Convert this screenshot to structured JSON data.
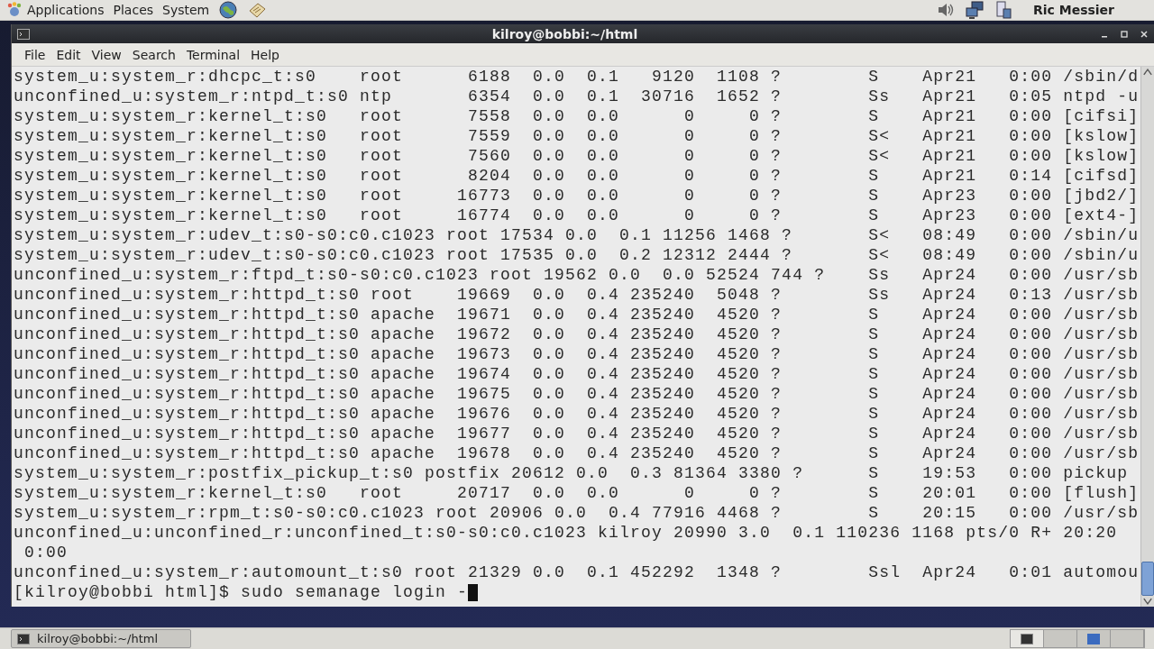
{
  "top_panel": {
    "menus": [
      "Applications",
      "Places",
      "System"
    ],
    "user": "Ric Messier"
  },
  "window": {
    "title": "kilroy@bobbi:~/html",
    "menu": [
      "File",
      "Edit",
      "View",
      "Search",
      "Terminal",
      "Help"
    ],
    "terminal": {
      "lines": [
        "system_u:system_r:dhcpc_t:s0    root      6188  0.0  0.1   9120  1108 ?        S    Apr21   0:00 /sbin/d",
        "unconfined_u:system_r:ntpd_t:s0 ntp       6354  0.0  0.1  30716  1652 ?        Ss   Apr21   0:05 ntpd -u",
        "system_u:system_r:kernel_t:s0   root      7558  0.0  0.0      0     0 ?        S    Apr21   0:00 [cifsi]",
        "system_u:system_r:kernel_t:s0   root      7559  0.0  0.0      0     0 ?        S<   Apr21   0:00 [kslow]",
        "system_u:system_r:kernel_t:s0   root      7560  0.0  0.0      0     0 ?        S<   Apr21   0:00 [kslow]",
        "system_u:system_r:kernel_t:s0   root      8204  0.0  0.0      0     0 ?        S    Apr21   0:14 [cifsd]",
        "system_u:system_r:kernel_t:s0   root     16773  0.0  0.0      0     0 ?        S    Apr23   0:00 [jbd2/]",
        "system_u:system_r:kernel_t:s0   root     16774  0.0  0.0      0     0 ?        S    Apr23   0:00 [ext4-]",
        "system_u:system_r:udev_t:s0-s0:c0.c1023 root 17534 0.0  0.1 11256 1468 ?       S<   08:49   0:00 /sbin/u",
        "system_u:system_r:udev_t:s0-s0:c0.c1023 root 17535 0.0  0.2 12312 2444 ?       S<   08:49   0:00 /sbin/u",
        "unconfined_u:system_r:ftpd_t:s0-s0:c0.c1023 root 19562 0.0  0.0 52524 744 ?    Ss   Apr24   0:00 /usr/sb",
        "unconfined_u:system_r:httpd_t:s0 root    19669  0.0  0.4 235240  5048 ?        Ss   Apr24   0:13 /usr/sb",
        "unconfined_u:system_r:httpd_t:s0 apache  19671  0.0  0.4 235240  4520 ?        S    Apr24   0:00 /usr/sb",
        "unconfined_u:system_r:httpd_t:s0 apache  19672  0.0  0.4 235240  4520 ?        S    Apr24   0:00 /usr/sb",
        "unconfined_u:system_r:httpd_t:s0 apache  19673  0.0  0.4 235240  4520 ?        S    Apr24   0:00 /usr/sb",
        "unconfined_u:system_r:httpd_t:s0 apache  19674  0.0  0.4 235240  4520 ?        S    Apr24   0:00 /usr/sb",
        "unconfined_u:system_r:httpd_t:s0 apache  19675  0.0  0.4 235240  4520 ?        S    Apr24   0:00 /usr/sb",
        "unconfined_u:system_r:httpd_t:s0 apache  19676  0.0  0.4 235240  4520 ?        S    Apr24   0:00 /usr/sb",
        "unconfined_u:system_r:httpd_t:s0 apache  19677  0.0  0.4 235240  4520 ?        S    Apr24   0:00 /usr/sb",
        "unconfined_u:system_r:httpd_t:s0 apache  19678  0.0  0.4 235240  4520 ?        S    Apr24   0:00 /usr/sb",
        "system_u:system_r:postfix_pickup_t:s0 postfix 20612 0.0  0.3 81364 3380 ?      S    19:53   0:00 pickup",
        "system_u:system_r:kernel_t:s0   root     20717  0.0  0.0      0     0 ?        S    20:01   0:00 [flush]",
        "system_u:system_r:rpm_t:s0-s0:c0.c1023 root 20906 0.0  0.4 77916 4468 ?        S    20:15   0:00 /usr/sb",
        "unconfined_u:unconfined_r:unconfined_t:s0-s0:c0.c1023 kilroy 20990 3.0  0.1 110236 1168 pts/0 R+ 20:20",
        " 0:00",
        "unconfined_u:system_r:automount_t:s0 root 21329 0.0  0.1 452292  1348 ?        Ssl  Apr24   0:01 automou"
      ],
      "input_line": "[kilroy@bobbi html]$ sudo semanage login -"
    }
  },
  "taskbar": {
    "tasks": [
      "kilroy@bobbi:~/html"
    ]
  }
}
